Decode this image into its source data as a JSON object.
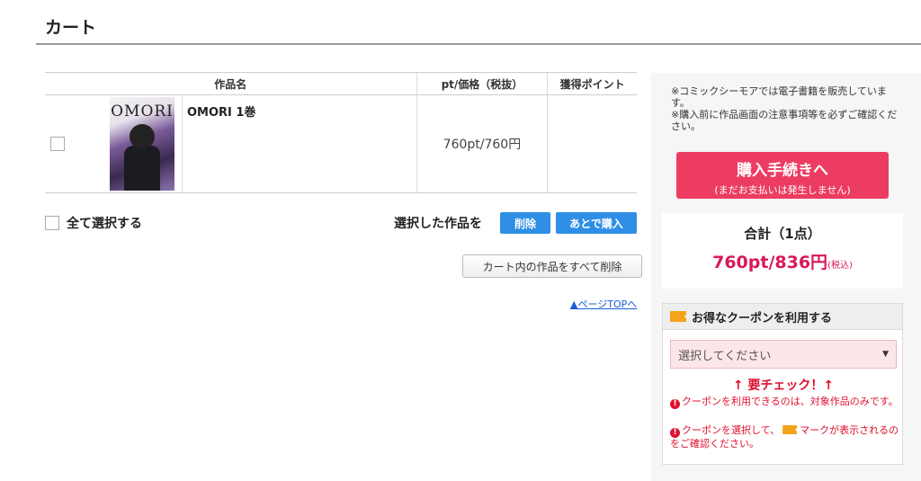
{
  "page": {
    "title": "カート"
  },
  "table": {
    "headers": [
      "作品名",
      "pt/価格（税抜）",
      "獲得ポイント"
    ],
    "items": [
      {
        "cover_title": "OMORI",
        "title": "OMORI 1巻",
        "price": "760pt/760円",
        "points": ""
      }
    ]
  },
  "actions": {
    "select_all": "全て選択する",
    "selected_label": "選択した作品を",
    "delete": "削除",
    "buy_later": "あとで購入",
    "clear_all": "カート内の作品をすべて削除",
    "page_top": "▲ページTOPへ"
  },
  "sidebar": {
    "notice_line1": "※コミックシーモアでは電子書籍を販売しています。",
    "notice_line2": "※購入前に作品画面の注意事項等を必ずご確認ください。",
    "purchase_main": "購入手続きへ",
    "purchase_sub": "(まだお支払いは発生しません)",
    "total_label": "合計（1点）",
    "total_amount": "760pt/836円",
    "tax_label": "(税込)",
    "coupon_header": "お得なクーポンを利用する",
    "coupon_placeholder": "選択してください",
    "check_required": "↑ 要チェック！↑",
    "warning1": "クーポンを利用できるのは、対象作品のみです。",
    "warning2a": "クーポンを選択して、",
    "warning2b": "マークが表示されるのをご確認ください。"
  },
  "colors": {
    "purchase_button": "#ec3c62",
    "blue_button": "#2f8fe6",
    "total_amount": "#d8185a",
    "warning": "#e0102e",
    "coupon_icon": "#f5a31a"
  }
}
